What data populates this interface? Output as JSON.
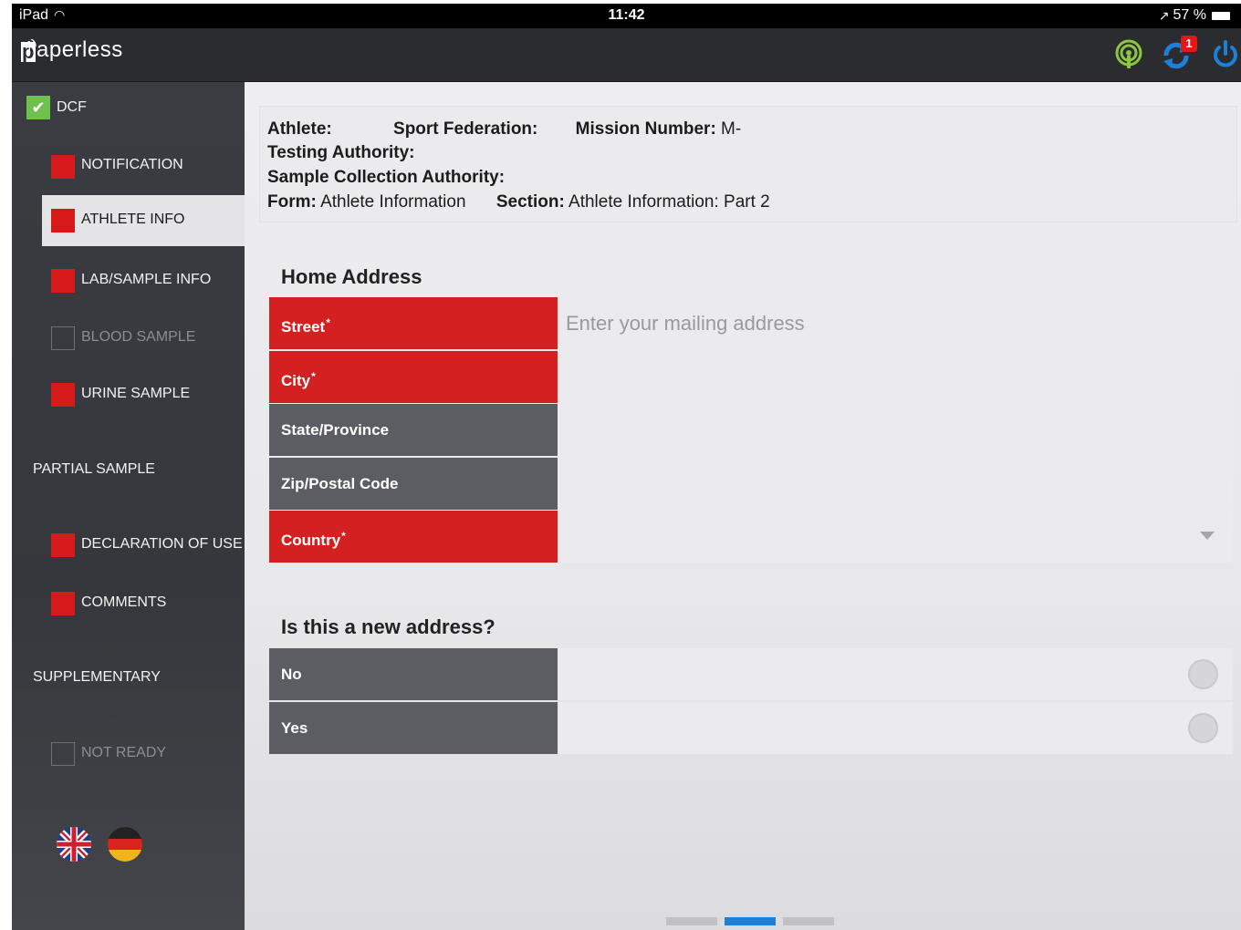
{
  "status_bar": {
    "device": "iPad",
    "time": "11:42",
    "battery": "57 %"
  },
  "header": {
    "logo_text": "aperless",
    "logo_letter": "p",
    "notification_count": "1",
    "icons": [
      "signal-icon",
      "sync-icon",
      "power-icon"
    ],
    "accent": "#1e7fd6"
  },
  "sidebar": {
    "top_section": "DCF",
    "items": [
      {
        "label": "NOTIFICATION",
        "status": "error"
      },
      {
        "label": "ATHLETE INFO",
        "status": "error",
        "active": true
      },
      {
        "label": "LAB/SAMPLE INFO",
        "status": "error"
      },
      {
        "label": "BLOOD SAMPLE",
        "status": "disabled"
      },
      {
        "label": "URINE SAMPLE",
        "status": "error"
      }
    ],
    "partial_sample": "PARTIAL SAMPLE",
    "items2": [
      {
        "label": "DECLARATION OF USE",
        "status": "error"
      },
      {
        "label": "COMMENTS",
        "status": "error"
      }
    ],
    "supplementary": "SUPPLEMENTARY",
    "not_ready": "NOT READY",
    "languages": [
      "uk-flag-icon",
      "german-flag-icon"
    ]
  },
  "info": {
    "athlete_label": "Athlete:",
    "sport_federation_label": "Sport Federation:",
    "mission_number_label": "Mission Number:",
    "mission_number_value": "M-",
    "testing_authority_label": "Testing Authority:",
    "sample_collection_authority_label": "Sample Collection Authority:",
    "form_label": "Form:",
    "form_value": "Athlete Information",
    "section_label": "Section:",
    "section_value": "Athlete Information: Part 2"
  },
  "home_address": {
    "title": "Home Address",
    "street_label": "Street",
    "street_placeholder": "Enter your mailing address",
    "city_label": "City",
    "state_label": "State/Province",
    "zip_label": "Zip/Postal Code",
    "country_label": "Country",
    "required_mark": "*"
  },
  "new_address": {
    "title": "Is this a new address?",
    "options": [
      "No",
      "Yes"
    ]
  },
  "colors": {
    "required": "#d42020",
    "optional": "#5b5d63",
    "success": "#6ec14a"
  },
  "pager": {
    "pages": 3,
    "current": 2
  }
}
